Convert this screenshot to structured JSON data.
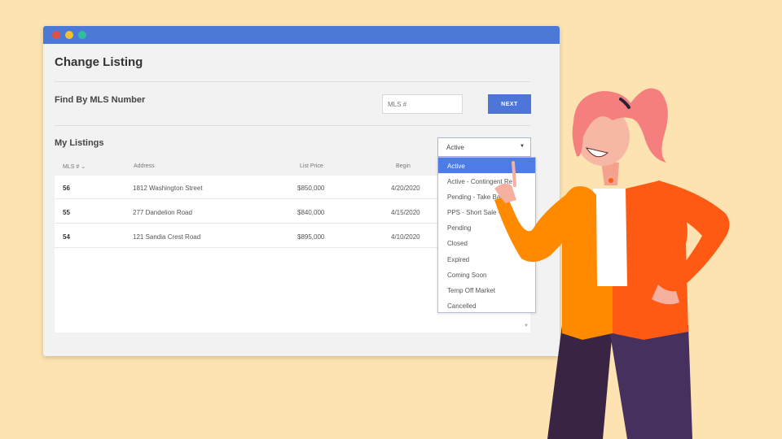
{
  "window": {
    "title": "Change Listing",
    "find_label": "Find By MLS Number",
    "mls_placeholder": "MLS #",
    "next_label": "NEXT",
    "my_listings_label": "My Listings",
    "status_selected": "Active"
  },
  "table": {
    "columns": [
      "MLS #",
      "Address",
      "List Price",
      "Begin"
    ],
    "rows": [
      {
        "mls": "56",
        "address": "1812 Washington Street",
        "price": "$850,000",
        "begin": "4/20/2020"
      },
      {
        "mls": "55",
        "address": "277 Dandelion Road",
        "price": "$840,000",
        "begin": "4/15/2020"
      },
      {
        "mls": "54",
        "address": "121 Sandia Crest Road",
        "price": "$895,000",
        "begin": "4/10/2020"
      }
    ]
  },
  "dropdown": {
    "options": [
      "Active",
      "Active - Contingent Re",
      "Pending - Take Bac",
      "PPS - Short Sale -",
      "Pending",
      "Closed",
      "Expired",
      "Coming Soon",
      "Temp Off Market",
      "Cancelled"
    ]
  },
  "colors": {
    "background": "#fde3b1",
    "titlebar": "#4c79d6",
    "accent": "#4d76d8",
    "jacket": "#ff5a14",
    "hair": "#f47f7e"
  },
  "icons": {
    "sort": "chevron-down-icon",
    "select": "caret-down-icon"
  }
}
